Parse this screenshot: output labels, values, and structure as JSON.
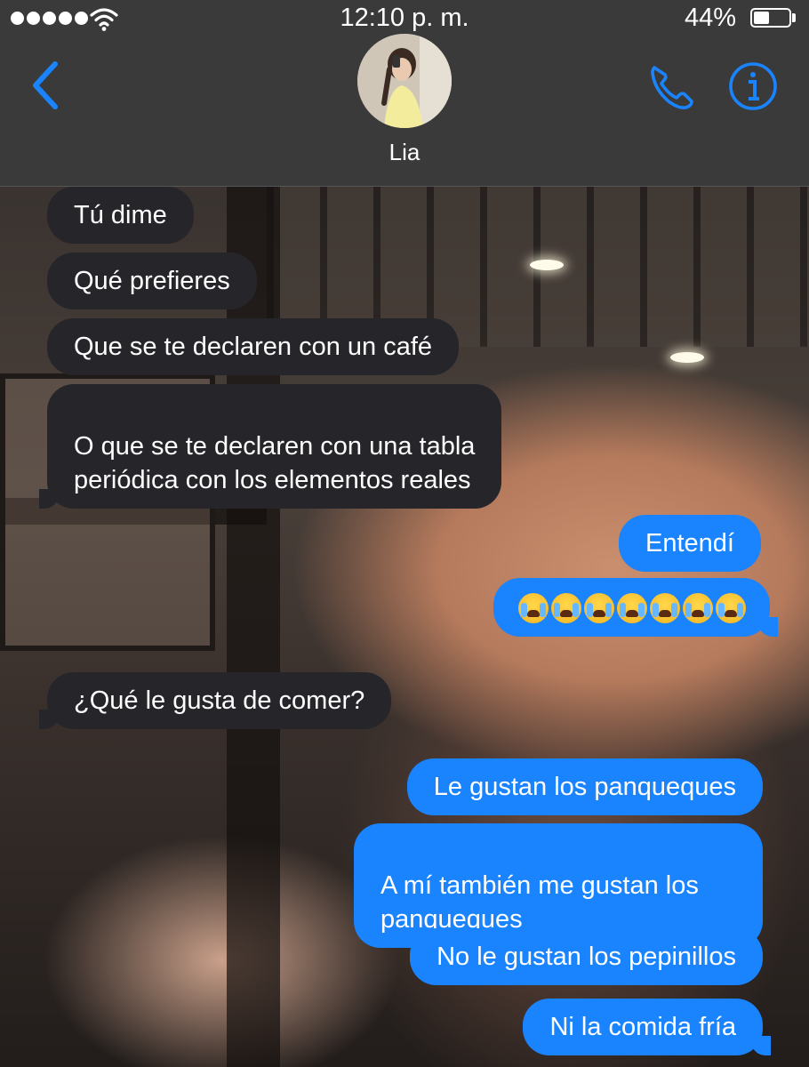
{
  "status_bar": {
    "time": "12:10 p. m.",
    "battery_percent": "44%",
    "battery_level": 0.44,
    "signal_bars": 5
  },
  "header": {
    "contact_name": "Lia",
    "back_icon": "chevron-left-icon",
    "call_icon": "phone-icon",
    "info_icon": "info-icon",
    "accent_color": "#1a84fe"
  },
  "messages": [
    {
      "direction": "incoming",
      "text": "Tú dime"
    },
    {
      "direction": "incoming",
      "text": "Qué prefieres"
    },
    {
      "direction": "incoming",
      "text": "Que se te declaren con un café"
    },
    {
      "direction": "incoming",
      "text": "O que se te declaren con una tabla\nperiódica con los elementos reales"
    },
    {
      "direction": "outgoing",
      "text": "Entendí"
    },
    {
      "direction": "outgoing",
      "text": "😭😭😭😭😭😭😭"
    },
    {
      "direction": "incoming",
      "text": "¿Qué le gusta de comer?"
    },
    {
      "direction": "outgoing",
      "text": "Le gustan los panqueques"
    },
    {
      "direction": "outgoing",
      "text": "A mí también me gustan los\npanqueques"
    },
    {
      "direction": "outgoing",
      "text": "No le gustan los pepinillos"
    },
    {
      "direction": "outgoing",
      "text": "Ni la comida fría"
    }
  ],
  "colors": {
    "incoming_bubble": "#26252a",
    "outgoing_bubble": "#1a84fe",
    "header_bg": "#3a3a3b"
  }
}
